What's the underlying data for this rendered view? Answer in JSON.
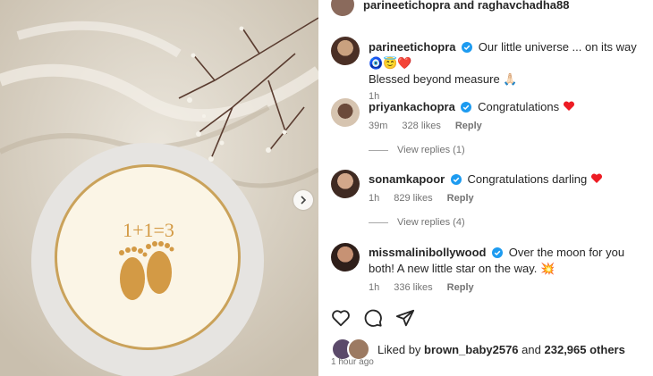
{
  "post_header": {
    "authors": "parineetichopra and raghavchadha88"
  },
  "caption": {
    "username": "parineetichopra",
    "text_line1": "Our little universe ... on its way",
    "emojis": "🧿😇❤️",
    "text_line2": "Blessed beyond measure",
    "trailing_glyphs": "🙏🏻",
    "time": "1h"
  },
  "comments": [
    {
      "username": "priyankachopra",
      "text": "Congratulations",
      "time": "39m",
      "likes": "328 likes",
      "reply": "Reply",
      "view_replies": "View replies (1)"
    },
    {
      "username": "sonamkapoor",
      "text": "Congratulations darling",
      "time": "1h",
      "likes": "829 likes",
      "reply": "Reply",
      "view_replies": "View replies (4)"
    },
    {
      "username": "missmalinibollywood",
      "text": "Over the moon for you both! A new little star on the way. 💥",
      "time": "1h",
      "likes": "336 likes",
      "reply": "Reply"
    }
  ],
  "cake_text": "1+1=3",
  "likes": {
    "prefix": "Liked by",
    "user": "brown_baby2576",
    "connector": "and",
    "count": "232,965 others"
  },
  "posted": "1 hour ago",
  "colors": {
    "verified": "#1d9bf0",
    "heart": "#ed1c24"
  }
}
